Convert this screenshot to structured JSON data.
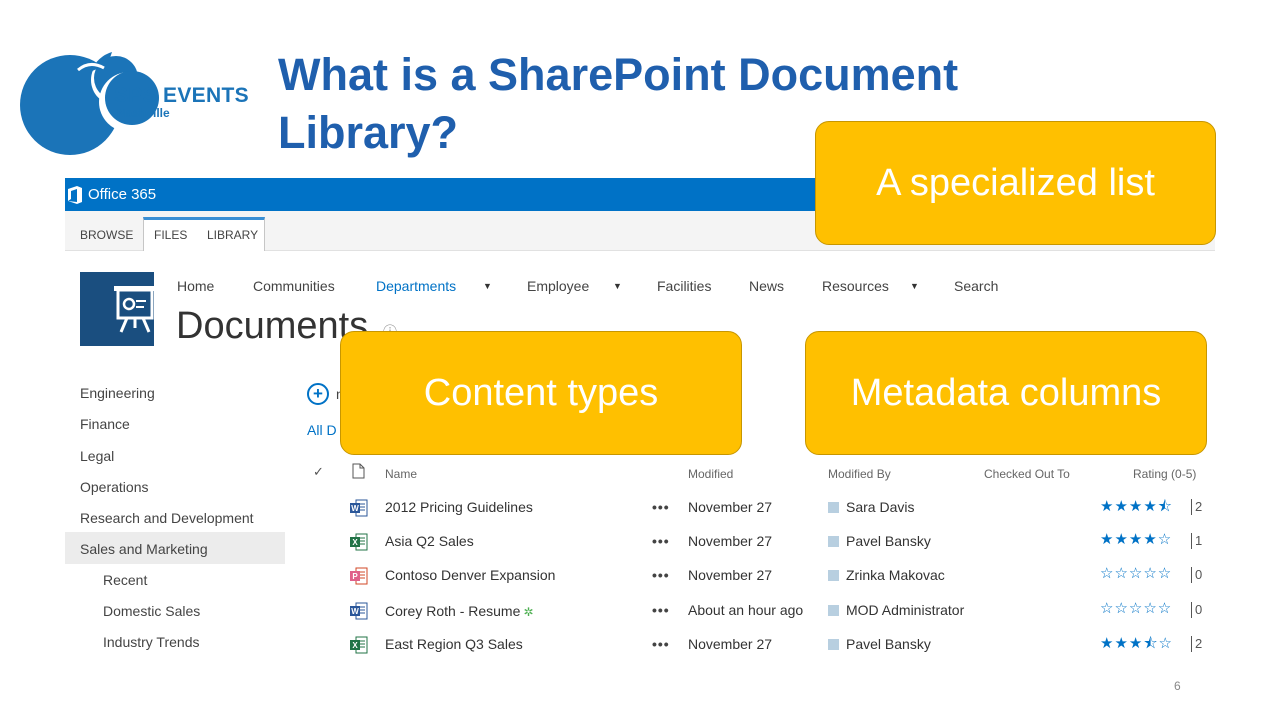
{
  "slide": {
    "title": "What is a SharePoint Document Library?",
    "page_number": "6"
  },
  "logo": {
    "name": "SPS EVENTS",
    "city": "Nashville",
    "color": "#1b74b8"
  },
  "suitebar": {
    "app_name": "Office 365",
    "color": "#0072c6"
  },
  "ribbon": {
    "tabs": [
      "BROWSE",
      "FILES",
      "LIBRARY"
    ]
  },
  "topnav": {
    "items": [
      {
        "label": "Home",
        "dropdown": false
      },
      {
        "label": "Communities",
        "dropdown": false
      },
      {
        "label": "Departments",
        "dropdown": true,
        "active": true
      },
      {
        "label": "Employee",
        "dropdown": true
      },
      {
        "label": "Facilities",
        "dropdown": false
      },
      {
        "label": "News",
        "dropdown": false
      },
      {
        "label": "Resources",
        "dropdown": true
      },
      {
        "label": "Search",
        "dropdown": false
      }
    ]
  },
  "page": {
    "title": "Documents",
    "new_fragment": "n",
    "view_fragment": "All D"
  },
  "leftnav": {
    "items": [
      "Engineering",
      "Finance",
      "Legal",
      "Operations",
      "Research and Development",
      "Sales and Marketing"
    ],
    "subitems": [
      "Recent",
      "Domestic Sales",
      "Industry Trends"
    ],
    "selected": "Sales and Marketing"
  },
  "table": {
    "headers": {
      "name": "Name",
      "modified": "Modified",
      "modified_by": "Modified By",
      "checked_out_to": "Checked Out To",
      "rating": "Rating (0-5)"
    },
    "rows": [
      {
        "type": "word",
        "name": "2012 Pricing Guidelines",
        "modified": "November 27",
        "modified_by": "Sara Davis",
        "rating": 4.5,
        "count": "2",
        "is_new": false
      },
      {
        "type": "excel",
        "name": "Asia Q2 Sales",
        "modified": "November 27",
        "modified_by": "Pavel Bansky",
        "rating": 4,
        "count": "1",
        "is_new": false
      },
      {
        "type": "powerpoint",
        "name": "Contoso Denver Expansion",
        "modified": "November 27",
        "modified_by": "Zrinka Makovac",
        "rating": 0,
        "count": "0",
        "is_new": false
      },
      {
        "type": "word",
        "name": "Corey Roth - Resume",
        "modified": "About an hour ago",
        "modified_by": "MOD Administrator",
        "rating": 0,
        "count": "0",
        "is_new": true
      },
      {
        "type": "excel",
        "name": "East Region Q3 Sales",
        "modified": "November 27",
        "modified_by": "Pavel Bansky",
        "rating": 3.5,
        "count": "2",
        "is_new": false
      }
    ]
  },
  "callouts": {
    "specialized_list": "A specialized list",
    "content_types": "Content types",
    "metadata_columns": "Metadata columns",
    "color": "#ffc000"
  }
}
